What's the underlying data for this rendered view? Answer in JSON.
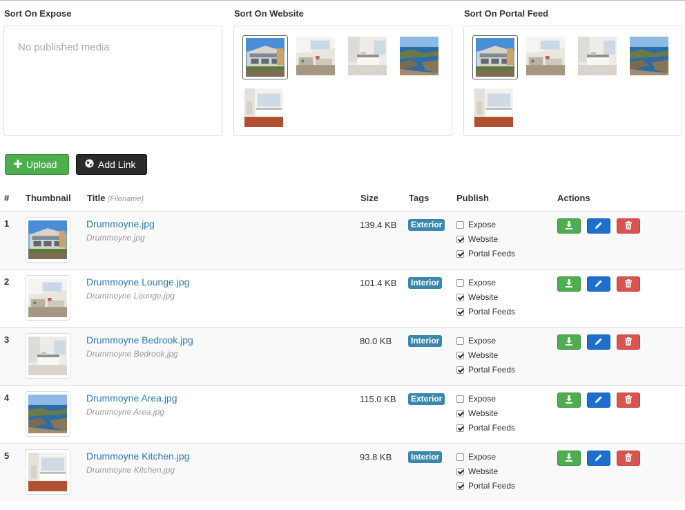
{
  "panels": {
    "expose": {
      "title": "Sort On Expose",
      "empty": "No published media"
    },
    "website": {
      "title": "Sort On Website"
    },
    "portal": {
      "title": "Sort On Portal Feed"
    }
  },
  "buttons": {
    "upload": "Upload",
    "add_link": "Add Link"
  },
  "table": {
    "headers": {
      "num": "#",
      "thumbnail": "Thumbnail",
      "title": "Title",
      "title_sub": "(Filename)",
      "size": "Size",
      "tags": "Tags",
      "publish": "Publish",
      "actions": "Actions"
    },
    "publish_labels": {
      "expose": "Expose",
      "website": "Website",
      "portal": "Portal Feeds"
    },
    "rows": [
      {
        "num": "1",
        "title": "Drummoyne.jpg",
        "filename": "Drummoyne.jpg",
        "size": "139.4 KB",
        "tag": "Exterior",
        "expose": false,
        "website": true,
        "portal": true
      },
      {
        "num": "2",
        "title": "Drummoyne Lounge.jpg",
        "filename": "Drummoyne Lounge.jpg",
        "size": "101.4 KB",
        "tag": "Interior",
        "expose": false,
        "website": true,
        "portal": true
      },
      {
        "num": "3",
        "title": "Drummoyne Bedrook.jpg",
        "filename": "Drummoyne Bedrook.jpg",
        "size": "80.0 KB",
        "tag": "Interior",
        "expose": false,
        "website": true,
        "portal": true
      },
      {
        "num": "4",
        "title": "Drummoyne Area.jpg",
        "filename": "Drummoyne Area.jpg",
        "size": "115.0 KB",
        "tag": "Exterior",
        "expose": false,
        "website": true,
        "portal": true
      },
      {
        "num": "5",
        "title": "Drummoyne Kitchen.jpg",
        "filename": "Drummoyne Kitchen.jpg",
        "size": "93.8 KB",
        "tag": "Interior",
        "expose": false,
        "website": true,
        "portal": true
      }
    ]
  },
  "icons": {
    "upload": "plus-icon",
    "add_link": "globe-icon",
    "download": "download-icon",
    "edit": "pencil-icon",
    "delete": "trash-icon"
  },
  "colors": {
    "success": "#4cae4c",
    "primary": "#1c6fcf",
    "danger": "#d9534f",
    "tag": "#3a87ad",
    "link": "#2a7ab8"
  }
}
